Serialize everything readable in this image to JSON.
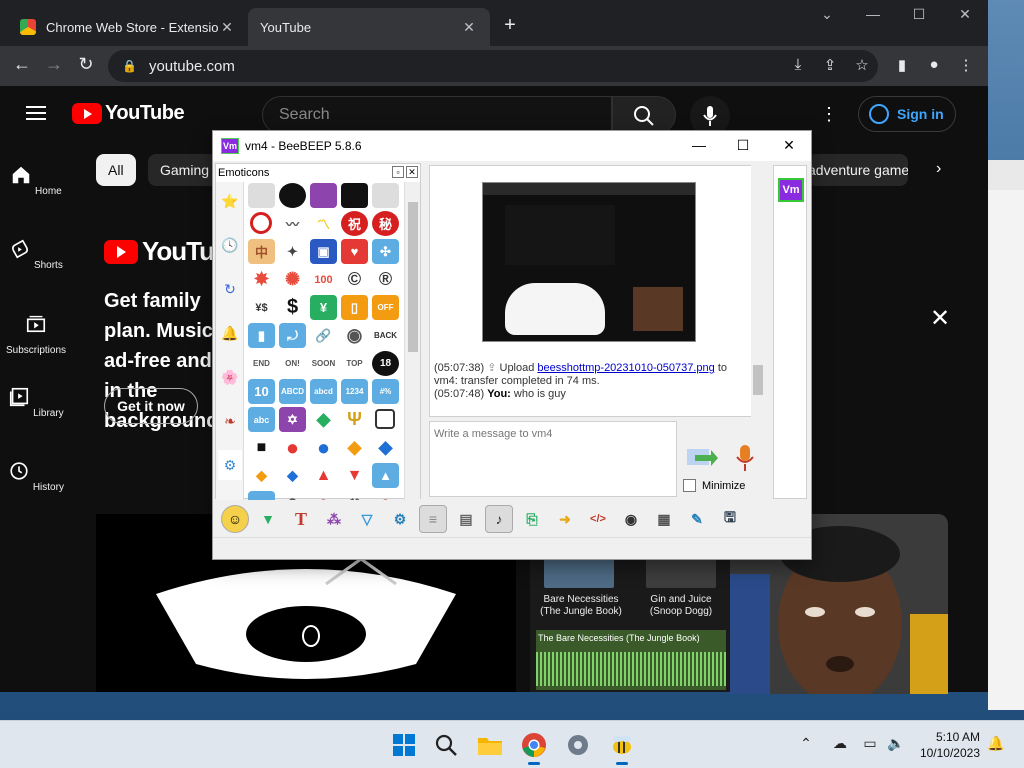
{
  "browser": {
    "tabs": [
      {
        "title": "Chrome Web Store - Extensions"
      },
      {
        "title": "YouTube"
      }
    ],
    "url": "youtube.com"
  },
  "youtube": {
    "logo_text": "YouTube",
    "search_placeholder": "Search",
    "signin_label": "Sign in",
    "sidebar": [
      {
        "label": "Home",
        "icon": "home-icon"
      },
      {
        "label": "Shorts",
        "icon": "shorts-icon"
      },
      {
        "label": "Subscriptions",
        "icon": "subscriptions-icon"
      },
      {
        "label": "Library",
        "icon": "library-icon"
      },
      {
        "label": "History",
        "icon": "history-icon"
      }
    ],
    "chips": [
      "All",
      "Gaming",
      "adventure game"
    ],
    "banner": {
      "logo_text": "YouTube",
      "text": "Get family plan. Music ad-free and in the background",
      "button": "Get it now"
    },
    "thumbnails": [
      {
        "title": "Bare Necessities (The Jungle Book)"
      },
      {
        "title": "Gin and Juice (Snoop Dogg)"
      }
    ],
    "track_label": "The Bare Necessities (The Jungle Book)"
  },
  "beebeep": {
    "title": "vm4 - BeeBEEP 5.8.6",
    "panel_title": "Emoticons",
    "user_initials": "Vm",
    "messages": [
      {
        "time": "(05:07:38)",
        "pre": "Upload",
        "file": "beesshottmp-20231010-050737.png",
        "post": "to vm4: transfer completed in 74 ms."
      },
      {
        "time": "(05:07:48)",
        "sender": "You:",
        "text": "who is guy"
      }
    ],
    "input_placeholder": "Write a message to vm4",
    "minimize_label": "Minimize",
    "emoji_tabs": [
      "⭐",
      "🕓",
      "↻",
      "🔔",
      "🌸",
      "❧",
      "⚙"
    ]
  },
  "taskbar": {
    "time": "5:10 AM",
    "date": "10/10/2023"
  },
  "colors": {
    "yt_red": "#ff0000",
    "yt_blue": "#3ea6ff",
    "bee_purple": "#8a2be2",
    "accent_green": "#37c837"
  }
}
